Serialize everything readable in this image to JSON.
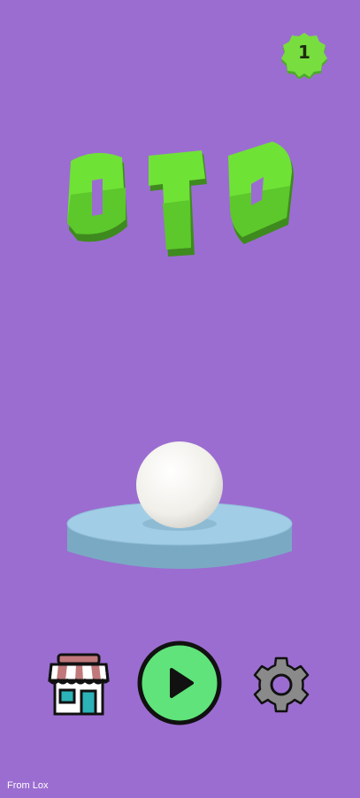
{
  "colors": {
    "background": "#9b6dd1",
    "accent_green": "#6fe236",
    "play_green": "#5fe37a",
    "platform_blue": "#9dc8e3"
  },
  "hud": {
    "level": "1",
    "level_icon": "level-badge-icon"
  },
  "title": {
    "text": "OTO"
  },
  "menu": {
    "shop_icon": "shop-icon",
    "play_icon": "play-icon",
    "settings_icon": "gear-icon"
  },
  "footer": {
    "credit": "From Lox"
  }
}
